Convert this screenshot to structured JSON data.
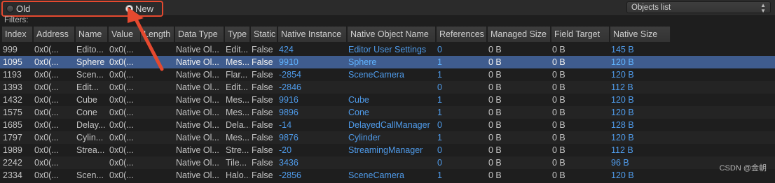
{
  "toolbar": {
    "radio_old": "Old",
    "radio_new": "New",
    "selected": "New",
    "dropdown_value": "Objects list"
  },
  "filters_label": "Filters:",
  "columns": [
    "Index",
    "Address",
    "Name",
    "Value",
    "Length",
    "Data Type",
    "Type",
    "Static",
    "Native Instance",
    "Native Object Name",
    "References",
    "Managed Size",
    "Field Target",
    "Native Size"
  ],
  "rows": [
    [
      "999",
      "0x0(...",
      "Edito...",
      "0x0(...",
      "",
      "Native Ol...",
      "Edit...",
      "False",
      "424",
      "Editor User Settings",
      "0",
      "0 B",
      "0 B",
      "145 B"
    ],
    [
      "1095",
      "0x0(...",
      "Sphere",
      "0x0(...",
      "",
      "Native Ol...",
      "Mes...",
      "False",
      "9910",
      "Sphere",
      "1",
      "0 B",
      "0 B",
      "120 B"
    ],
    [
      "1193",
      "0x0(...",
      "Scen...",
      "0x0(...",
      "",
      "Native Ol...",
      "Flar...",
      "False",
      "-2854",
      "SceneCamera",
      "1",
      "0 B",
      "0 B",
      "120 B"
    ],
    [
      "1393",
      "0x0(...",
      "Edit...",
      "0x0(...",
      "",
      "Native Ol...",
      "Edit...",
      "False",
      "-2846",
      "",
      "0",
      "0 B",
      "0 B",
      "112 B"
    ],
    [
      "1432",
      "0x0(...",
      "Cube",
      "0x0(...",
      "",
      "Native Ol...",
      "Mes...",
      "False",
      "9916",
      "Cube",
      "1",
      "0 B",
      "0 B",
      "120 B"
    ],
    [
      "1575",
      "0x0(...",
      "Cone",
      "0x0(...",
      "",
      "Native Ol...",
      "Mes...",
      "False",
      "9896",
      "Cone",
      "1",
      "0 B",
      "0 B",
      "120 B"
    ],
    [
      "1685",
      "0x0(...",
      "Delay...",
      "0x0(...",
      "",
      "Native Ol...",
      "Dela...",
      "False",
      "-14",
      "DelayedCallManager",
      "0",
      "0 B",
      "0 B",
      "128 B"
    ],
    [
      "1797",
      "0x0(...",
      "Cylin...",
      "0x0(...",
      "",
      "Native Ol...",
      "Mes...",
      "False",
      "9876",
      "Cylinder",
      "1",
      "0 B",
      "0 B",
      "120 B"
    ],
    [
      "1989",
      "0x0(...",
      "Strea...",
      "0x0(...",
      "",
      "Native Ol...",
      "Stre...",
      "False",
      "-20",
      "StreamingManager",
      "0",
      "0 B",
      "0 B",
      "112 B"
    ],
    [
      "2242",
      "0x0(...",
      "",
      "0x0(...",
      "",
      "Native Ol...",
      "Tile...",
      "False",
      "3436",
      "",
      "0",
      "0 B",
      "0 B",
      "96 B"
    ],
    [
      "2334",
      "0x0(...",
      "Scen...",
      "0x0(...",
      "",
      "Native Ol...",
      "Halo...",
      "False",
      "-2856",
      "SceneCamera",
      "1",
      "0 B",
      "0 B",
      "120 B"
    ]
  ],
  "selected_row": 1,
  "watermark": "CSDN @金朝",
  "colors": {
    "accent_red": "#e5492f",
    "link_blue": "#4f9bea",
    "selection": "#3f5c8e"
  }
}
